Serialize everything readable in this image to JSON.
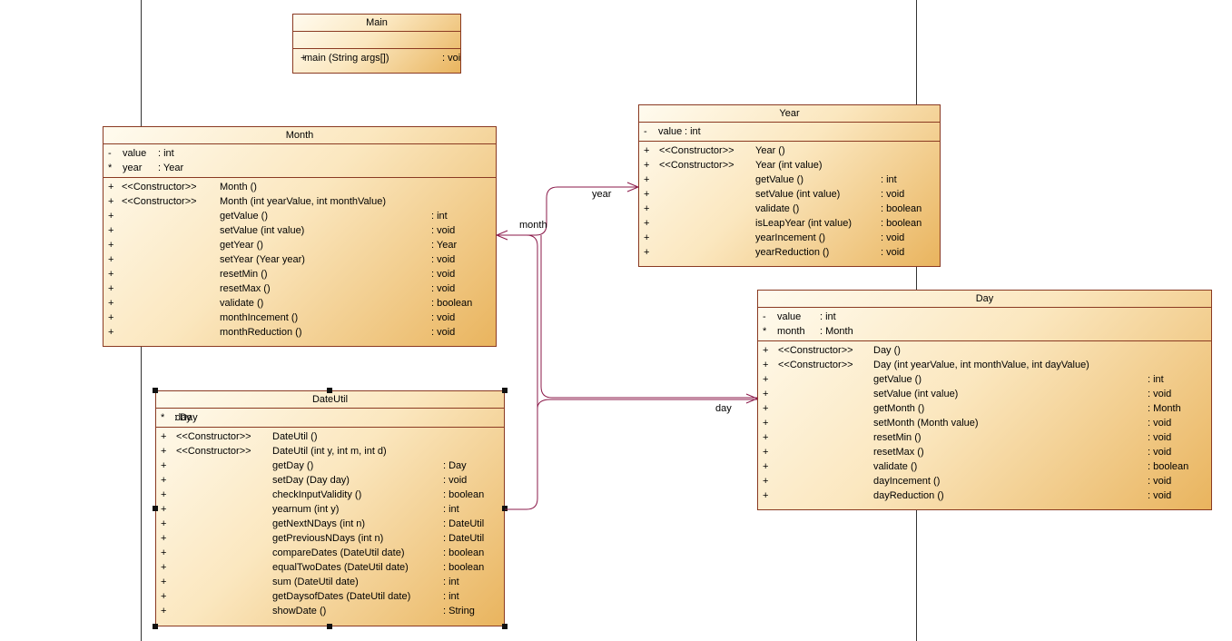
{
  "diagram": {
    "classes": {
      "main": {
        "name": "Main",
        "attributes": [],
        "operations": [
          {
            "vis": "+",
            "stereo": "",
            "name": "main (String args[])",
            "type": ": void"
          }
        ]
      },
      "month": {
        "name": "Month",
        "attributes": [
          {
            "vis": "-",
            "name": "value",
            "type": ": int"
          },
          {
            "vis": "*",
            "name": "year",
            "type": ": Year"
          }
        ],
        "operations": [
          {
            "vis": "+",
            "stereo": "<<Constructor>>",
            "name": "Month ()",
            "type": ""
          },
          {
            "vis": "+",
            "stereo": "<<Constructor>>",
            "name": "Month (int yearValue, int monthValue)",
            "type": ""
          },
          {
            "vis": "+",
            "stereo": "",
            "name": "getValue ()",
            "type": ": int"
          },
          {
            "vis": "+",
            "stereo": "",
            "name": "setValue (int value)",
            "type": ": void"
          },
          {
            "vis": "+",
            "stereo": "",
            "name": "getYear ()",
            "type": ": Year"
          },
          {
            "vis": "+",
            "stereo": "",
            "name": "setYear (Year year)",
            "type": ": void"
          },
          {
            "vis": "+",
            "stereo": "",
            "name": "resetMin ()",
            "type": ": void"
          },
          {
            "vis": "+",
            "stereo": "",
            "name": "resetMax ()",
            "type": ": void"
          },
          {
            "vis": "+",
            "stereo": "",
            "name": "validate ()",
            "type": ": boolean"
          },
          {
            "vis": "+",
            "stereo": "",
            "name": "monthIncement ()",
            "type": ": void"
          },
          {
            "vis": "+",
            "stereo": "",
            "name": "monthReduction ()",
            "type": ": void"
          }
        ]
      },
      "year": {
        "name": "Year",
        "attributes": [
          {
            "vis": "-",
            "name": "value",
            "type": ": int"
          }
        ],
        "operations": [
          {
            "vis": "+",
            "stereo": "<<Constructor>>",
            "name": "Year ()",
            "type": ""
          },
          {
            "vis": "+",
            "stereo": "<<Constructor>>",
            "name": "Year (int value)",
            "type": ""
          },
          {
            "vis": "+",
            "stereo": "",
            "name": "getValue ()",
            "type": ": int"
          },
          {
            "vis": "+",
            "stereo": "",
            "name": "setValue (int value)",
            "type": ": void"
          },
          {
            "vis": "+",
            "stereo": "",
            "name": "validate ()",
            "type": ": boolean"
          },
          {
            "vis": "+",
            "stereo": "",
            "name": "isLeapYear (int value)",
            "type": ": boolean"
          },
          {
            "vis": "+",
            "stereo": "",
            "name": "yearIncement ()",
            "type": ": void"
          },
          {
            "vis": "+",
            "stereo": "",
            "name": "yearReduction ()",
            "type": ": void"
          }
        ]
      },
      "day": {
        "name": "Day",
        "attributes": [
          {
            "vis": "-",
            "name": "value",
            "type": ": int"
          },
          {
            "vis": "*",
            "name": "month",
            "type": ": Month"
          }
        ],
        "operations": [
          {
            "vis": "+",
            "stereo": "<<Constructor>>",
            "name": "Day ()",
            "type": ""
          },
          {
            "vis": "+",
            "stereo": "<<Constructor>>",
            "name": "Day (int yearValue, int monthValue, int dayValue)",
            "type": ""
          },
          {
            "vis": "+",
            "stereo": "",
            "name": "getValue ()",
            "type": ": int"
          },
          {
            "vis": "+",
            "stereo": "",
            "name": "setValue (int value)",
            "type": ": void"
          },
          {
            "vis": "+",
            "stereo": "",
            "name": "getMonth ()",
            "type": ": Month"
          },
          {
            "vis": "+",
            "stereo": "",
            "name": "setMonth (Month value)",
            "type": ": void"
          },
          {
            "vis": "+",
            "stereo": "",
            "name": "resetMin ()",
            "type": ": void"
          },
          {
            "vis": "+",
            "stereo": "",
            "name": "resetMax ()",
            "type": ": void"
          },
          {
            "vis": "+",
            "stereo": "",
            "name": "validate ()",
            "type": ": boolean"
          },
          {
            "vis": "+",
            "stereo": "",
            "name": "dayIncement ()",
            "type": ": void"
          },
          {
            "vis": "+",
            "stereo": "",
            "name": "dayReduction ()",
            "type": ": void"
          }
        ]
      },
      "dateutil": {
        "name": "DateUtil",
        "attributes": [
          {
            "vis": "*",
            "name": "day",
            "type": ": Day"
          }
        ],
        "operations": [
          {
            "vis": "+",
            "stereo": "<<Constructor>>",
            "name": "DateUtil ()",
            "type": ""
          },
          {
            "vis": "+",
            "stereo": "<<Constructor>>",
            "name": "DateUtil (int y, int m, int d)",
            "type": ""
          },
          {
            "vis": "+",
            "stereo": "",
            "name": "getDay ()",
            "type": ": Day"
          },
          {
            "vis": "+",
            "stereo": "",
            "name": "setDay (Day day)",
            "type": ": void"
          },
          {
            "vis": "+",
            "stereo": "",
            "name": "checkInputValidity ()",
            "type": ": boolean"
          },
          {
            "vis": "+",
            "stereo": "",
            "name": "yearnum (int y)",
            "type": ": int"
          },
          {
            "vis": "+",
            "stereo": "",
            "name": "getNextNDays (int n)",
            "type": ": DateUtil"
          },
          {
            "vis": "+",
            "stereo": "",
            "name": "getPreviousNDays (int n)",
            "type": ": DateUtil"
          },
          {
            "vis": "+",
            "stereo": "",
            "name": "compareDates (DateUtil date)",
            "type": ": boolean"
          },
          {
            "vis": "+",
            "stereo": "",
            "name": "equalTwoDates (DateUtil date)",
            "type": ": boolean"
          },
          {
            "vis": "+",
            "stereo": "",
            "name": "sum (DateUtil date)",
            "type": ": int"
          },
          {
            "vis": "+",
            "stereo": "",
            "name": "getDaysofDates (DateUtil date)",
            "type": ": int"
          },
          {
            "vis": "+",
            "stereo": "",
            "name": "showDate ()",
            "type": ": String"
          }
        ]
      }
    },
    "associations": {
      "year_role": "year",
      "month_role": "month",
      "day_role": "day"
    },
    "colors": {
      "border": "#8a3a22",
      "link": "#8b1a4a",
      "fill_light": "#fffbef",
      "fill_dark": "#e9b45e"
    }
  }
}
